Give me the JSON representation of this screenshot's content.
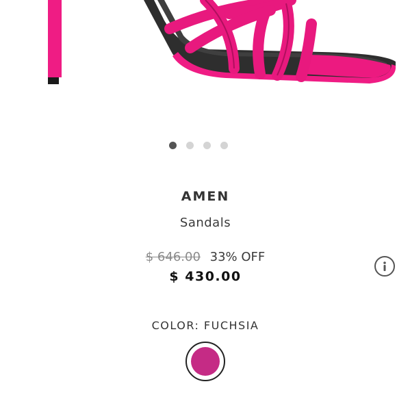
{
  "product": {
    "brand": "AMEN",
    "category": "Sandals",
    "original_price": "$ 646.00",
    "discount": "33% OFF",
    "current_price": "$ 430.00"
  },
  "carousel": {
    "total_slides": 4,
    "active_slide": 1
  },
  "color": {
    "label": "COLOR: FUCHSIA",
    "swatch_hex": "#c52b85"
  },
  "colors": {
    "fuchsia_strap": "#e8197e",
    "text_dark": "#333333"
  },
  "icons": {
    "info": "info-icon"
  }
}
